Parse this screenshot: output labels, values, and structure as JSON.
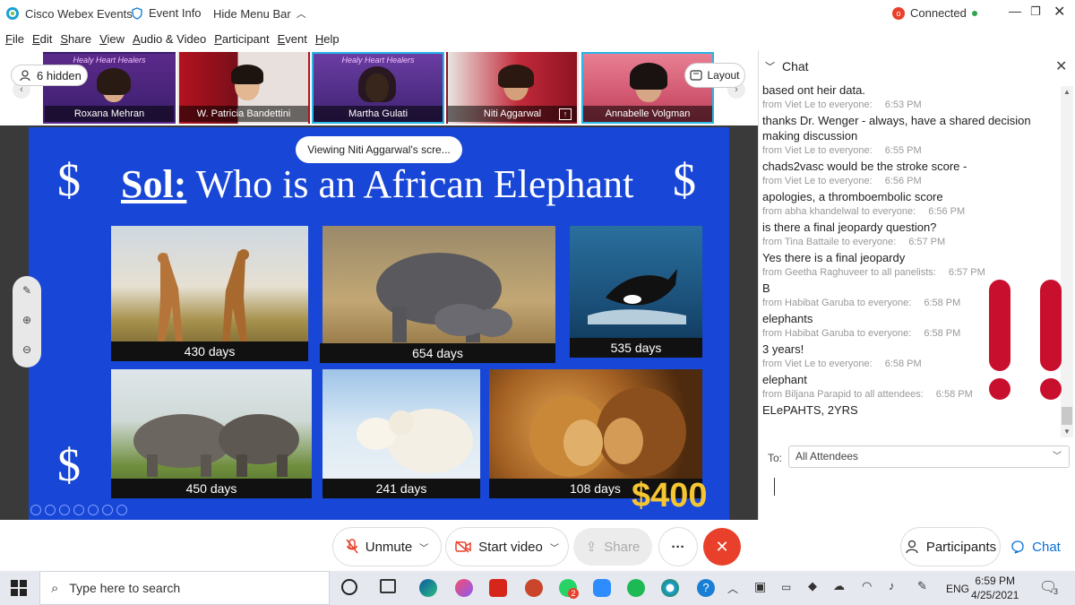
{
  "titlebar": {
    "app": "Cisco Webex Events",
    "event_info": "Event Info",
    "hide_menu": "Hide Menu Bar",
    "status": "Connected"
  },
  "menu": [
    "File",
    "Edit",
    "Share",
    "View",
    "Audio & Video",
    "Participant",
    "Event",
    "Help"
  ],
  "participants_bar": {
    "hidden_count": "6 hidden",
    "layout_label": "Layout",
    "thumbnails": [
      {
        "name": "Roxana Mehran",
        "banner": "Healy Heart Healers"
      },
      {
        "name": "W. Patricia Bandettini"
      },
      {
        "name": "Martha Gulati",
        "banner": "Healy Heart Healers"
      },
      {
        "name": "Niti Aggarwal"
      },
      {
        "name": "Annabelle Volgman"
      }
    ]
  },
  "share": {
    "viewing": "Viewing Niti Aggarwal's scre...",
    "slide": {
      "title_bold": "Sol:",
      "title_rest": " Who is an African Elephant",
      "dollar": "$",
      "amount": "$400",
      "cards": [
        {
          "animal": "giraffes",
          "caption": "430 days"
        },
        {
          "animal": "elephants",
          "caption": "654 days"
        },
        {
          "animal": "orca",
          "caption": "535 days"
        },
        {
          "animal": "rhinos",
          "caption": "450 days"
        },
        {
          "animal": "polar bears",
          "caption": "241 days"
        },
        {
          "animal": "lions",
          "caption": "108 days"
        }
      ]
    }
  },
  "chat": {
    "title": "Chat",
    "messages": [
      {
        "text": "based ont heir data.",
        "from": "from Viet Le to everyone:",
        "time": "6:53 PM"
      },
      {
        "text": "thanks Dr. Wenger - always, have a shared decision making discussion",
        "from": "from Viet Le to everyone:",
        "time": "6:55 PM"
      },
      {
        "text": "chads2vasc would be the stroke score -",
        "from": "from Viet Le to everyone:",
        "time": "6:56 PM"
      },
      {
        "text": "apologies, a thromboembolic score",
        "from": "from abha khandelwal to everyone:",
        "time": "6:56 PM"
      },
      {
        "text": "is there a final jeopardy question?",
        "from": "from Tina Battaile to everyone:",
        "time": "6:57 PM"
      },
      {
        "text": "Yes there is a final jeopardy",
        "from": "from Geetha Raghuveer to all panelists:",
        "time": "6:57 PM"
      },
      {
        "text": "B",
        "from": "from Habibat Garuba to everyone:",
        "time": "6:58 PM"
      },
      {
        "text": "elephants",
        "from": "from Habibat Garuba to everyone:",
        "time": "6:58 PM"
      },
      {
        "text": "3 years!",
        "from": "from Viet Le to everyone:",
        "time": "6:58 PM"
      },
      {
        "text": "elephant",
        "from": "from Biljana Parapid to all attendees:",
        "time": "6:58 PM"
      },
      {
        "text": "ELePAHTS, 2YRS",
        "from": "",
        "time": ""
      }
    ],
    "to_label": "To:",
    "to_value": "All Attendees"
  },
  "controls": {
    "unmute": "Unmute",
    "start_video": "Start video",
    "share": "Share",
    "more": "···",
    "participants": "Participants",
    "chat": "Chat"
  },
  "taskbar": {
    "search": "Type here to search",
    "lang": "ENG",
    "time": "6:59 PM",
    "date": "4/25/2021",
    "whatsapp_badge": "2",
    "notif_count": "3"
  },
  "colors": {
    "slide_bg": "#1846d6",
    "amount": "#f6c632",
    "end_call": "#e8402a",
    "accent": "#29b6e8",
    "webex_blue": "#0a6fd6"
  }
}
